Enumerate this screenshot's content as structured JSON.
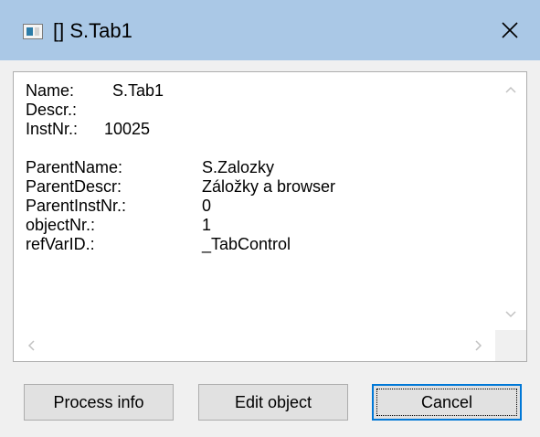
{
  "window": {
    "title": "[] S.Tab1"
  },
  "info": {
    "name_label": "Name:",
    "name_value": "S.Tab1",
    "descr_label": "Descr.:",
    "descr_value": "",
    "instnr_label": "InstNr.:",
    "instnr_value": "10025",
    "parent_name_label": "ParentName:",
    "parent_name_value": "S.Zalozky",
    "parent_descr_label": "ParentDescr:",
    "parent_descr_value": "Záložky a browser",
    "parent_instnr_label": "ParentInstNr.:",
    "parent_instnr_value": "0",
    "objectnr_label": "objectNr.:",
    "objectnr_value": "1",
    "refvarid_label": "refVarID.:",
    "refvarid_value": "_TabControl"
  },
  "buttons": {
    "process_info": "Process info",
    "edit_object": "Edit object",
    "cancel": "Cancel"
  },
  "icons": {
    "app": "window-app-icon",
    "close": "close-icon",
    "scroll_up": "chevron-up-icon",
    "scroll_down": "chevron-down-icon",
    "scroll_left": "chevron-left-icon",
    "scroll_right": "chevron-right-icon"
  },
  "colors": {
    "titlebar": "#aac8e6",
    "accent": "#0078d7"
  }
}
